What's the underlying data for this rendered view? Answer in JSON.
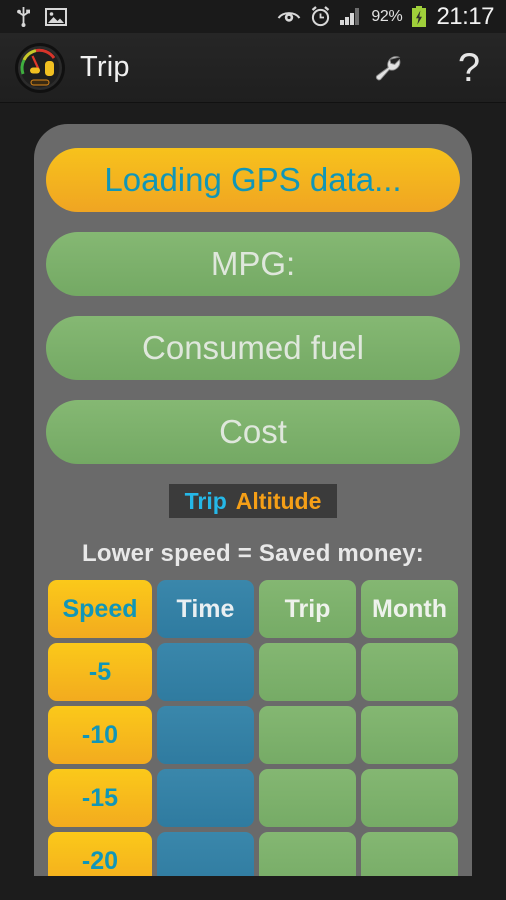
{
  "statusbar": {
    "icons_left": [
      "usb-icon",
      "image-icon"
    ],
    "icons_right": [
      "eye-icon",
      "alarm-icon",
      "signal-icon"
    ],
    "battery_percent": "92%",
    "battery_state": "charging",
    "time": "21:17"
  },
  "actionbar": {
    "logo": "gauge-logo-icon",
    "title": "Trip",
    "actions": [
      {
        "name": "wrench-icon",
        "label": ""
      },
      {
        "name": "help-icon",
        "label": "?"
      }
    ]
  },
  "main": {
    "status_button": {
      "label": "Loading GPS data...",
      "state": "loading"
    },
    "stat_buttons": [
      {
        "label": "MPG:"
      },
      {
        "label": "Consumed fuel"
      },
      {
        "label": "Cost"
      }
    ],
    "tabs": [
      {
        "label": "Trip",
        "selected": true
      },
      {
        "label": "Altitude",
        "selected": false
      }
    ],
    "section_title": "Lower speed = Saved money:",
    "table": {
      "headers": [
        "Speed",
        "Time",
        "Trip",
        "Month"
      ],
      "rows": [
        {
          "speed": "-5",
          "time": "",
          "trip": "",
          "month": ""
        },
        {
          "speed": "-10",
          "time": "",
          "trip": "",
          "month": ""
        },
        {
          "speed": "-15",
          "time": "",
          "trip": "",
          "month": ""
        },
        {
          "speed": "-20",
          "time": "",
          "trip": "",
          "month": ""
        }
      ]
    }
  },
  "colors": {
    "accent_yellow": "#f7c21c",
    "accent_cyan": "#1196b7",
    "accent_green": "#7ab169",
    "accent_blue": "#3a87ab",
    "accent_orange": "#f59f17",
    "panel_grey": "#6a6a6a",
    "background_dark": "#1c1c1c"
  }
}
